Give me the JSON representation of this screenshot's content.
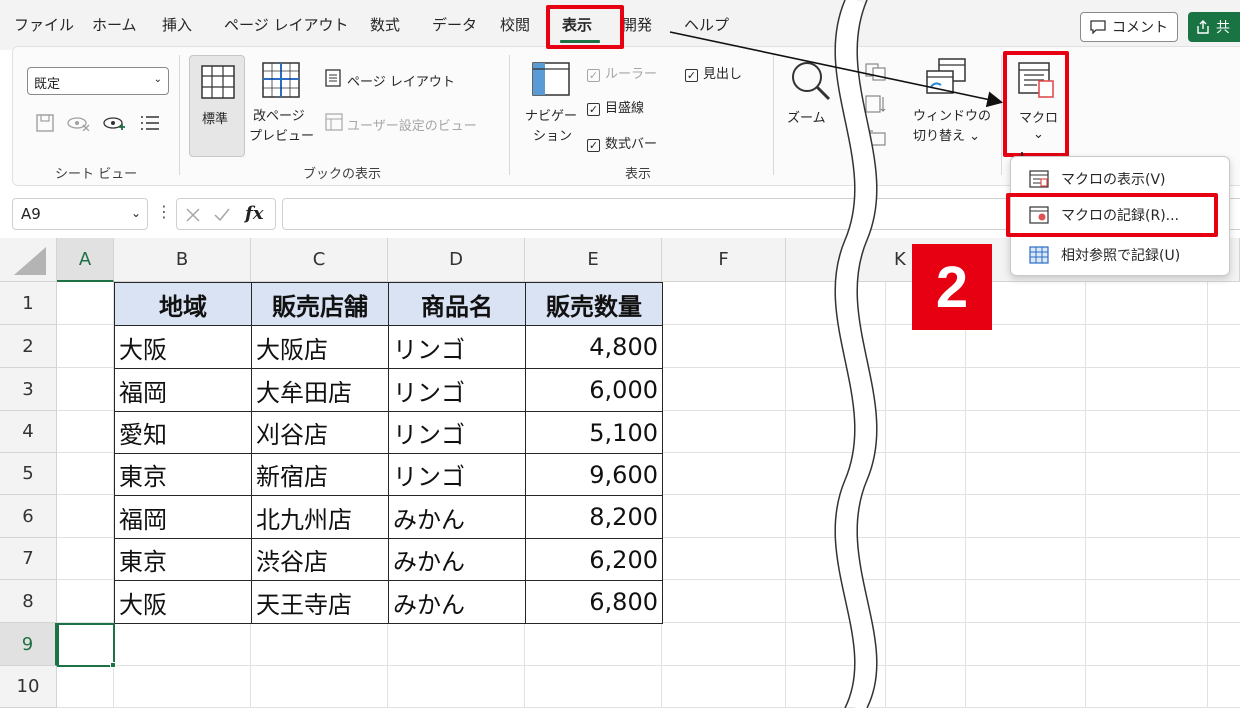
{
  "menu": {
    "tabs": [
      "ファイル",
      "ホーム",
      "挿入",
      "ページ レイアウト",
      "数式",
      "データ",
      "校閲",
      "表示",
      "開発",
      "ヘルプ"
    ],
    "active_tab": "表示",
    "comment_label": "コメント",
    "share_label": "共"
  },
  "ribbon": {
    "sheet_view": {
      "select_value": "既定",
      "group_label": "シート ビュー"
    },
    "workbook_views": {
      "normal": "標準",
      "page_break_1": "改ページ",
      "page_break_2": "プレビュー",
      "page_layout": "ページ レイアウト",
      "custom_views": "ユーザー設定のビュー",
      "group_label": "ブックの表示"
    },
    "show": {
      "navigation_1": "ナビゲー",
      "navigation_2": "ション",
      "ruler": "ルーラー",
      "gridlines": "目盛線",
      "formula_bar": "数式バー",
      "headings": "見出し",
      "group_label": "表示"
    },
    "zoom_label": "ズーム",
    "window": {
      "switch_1": "ウィンドウの",
      "switch_2": "切り替え"
    },
    "macros_label": "マクロ"
  },
  "formula_bar": {
    "name_box": "A9",
    "fx_label": "fx"
  },
  "grid": {
    "columns": [
      "A",
      "B",
      "C",
      "D",
      "E",
      "F",
      "K"
    ],
    "rows": [
      "1",
      "2",
      "3",
      "4",
      "5",
      "6",
      "7",
      "8",
      "9",
      "10"
    ],
    "table": {
      "headers": [
        "地域",
        "販売店舗",
        "商品名",
        "販売数量"
      ],
      "rows": [
        [
          "大阪",
          "大阪店",
          "リンゴ",
          "4,800"
        ],
        [
          "福岡",
          "大牟田店",
          "リンゴ",
          "6,000"
        ],
        [
          "愛知",
          "刈谷店",
          "リンゴ",
          "5,100"
        ],
        [
          "東京",
          "新宿店",
          "リンゴ",
          "9,600"
        ],
        [
          "福岡",
          "北九州店",
          "みかん",
          "8,200"
        ],
        [
          "東京",
          "渋谷店",
          "みかん",
          "6,200"
        ],
        [
          "大阪",
          "天王寺店",
          "みかん",
          "6,800"
        ]
      ]
    }
  },
  "macro_menu": {
    "items": [
      "マクロの表示(V)",
      "マクロの記録(R)...",
      "相対参照で記録(U)"
    ]
  },
  "annotation": {
    "step_number": "2",
    "highlight_color": "#e60012",
    "accent_green": "#1e7145"
  }
}
